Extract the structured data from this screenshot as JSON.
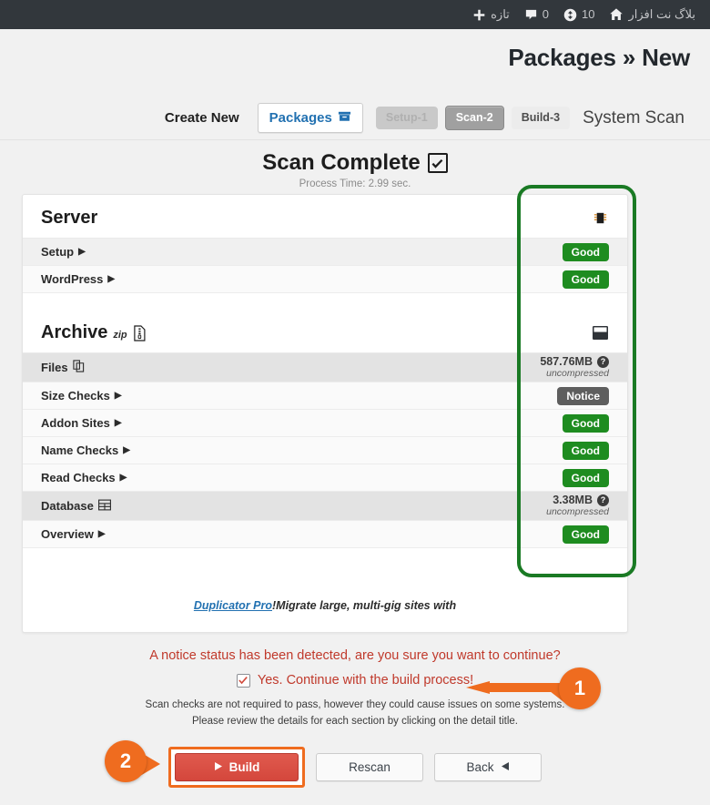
{
  "adminbar": {
    "home_icon": "home-icon",
    "site_name": "بلاگ نت افزار",
    "updates_icon": "updates-icon",
    "updates_count": "10",
    "comments_icon": "comments-icon",
    "comments_count": "0",
    "new_icon": "plus-icon",
    "new_label": "تازه"
  },
  "header": {
    "title": "Packages",
    "separator": "»",
    "subtitle": "New"
  },
  "nav": {
    "create_new": "Create New",
    "packages_label": "Packages",
    "packages_icon": "package-box-icon",
    "system_scan": "System Scan",
    "steps": [
      {
        "label": "Setup-1",
        "state": "todo"
      },
      {
        "label": "Scan-2",
        "state": "active"
      },
      {
        "label": "Build-3",
        "state": "done"
      }
    ]
  },
  "scan": {
    "title": "Scan Complete",
    "check_icon": "checkbox-checked-icon",
    "process_time": ".Process Time: 2.99 sec"
  },
  "sections": [
    {
      "name": "Server",
      "icon": "microchip-icon",
      "rows": [
        {
          "label": "Setup",
          "caret": "▶",
          "status": "Good",
          "kind": "good",
          "shade": "shade"
        },
        {
          "label": "WordPress",
          "caret": "▶",
          "status": "Good",
          "kind": "good",
          "shade": "white"
        }
      ]
    },
    {
      "name": "Archive",
      "sup": "zip",
      "sup_icon": "zip-file-icon",
      "icon": "archive-box-icon",
      "rows": [
        {
          "label": "Files",
          "icon": "copy-files-icon",
          "kind": "group",
          "size": "587.76MB",
          "size_note": "uncompressed",
          "shade": "group"
        },
        {
          "label": "Size Checks",
          "caret": "▶",
          "status": "Notice",
          "kind": "notice",
          "shade": "white"
        },
        {
          "label": "Addon Sites",
          "caret": "▶",
          "status": "Good",
          "kind": "good",
          "shade": "white"
        },
        {
          "label": "Name Checks",
          "caret": "▶",
          "status": "Good",
          "kind": "good",
          "shade": "white"
        },
        {
          "label": "Read Checks",
          "caret": "▶",
          "status": "Good",
          "kind": "good",
          "shade": "white"
        },
        {
          "label": "Database",
          "icon": "table-grid-icon",
          "kind": "group",
          "size": "3.38MB",
          "size_note": "uncompressed",
          "shade": "group"
        },
        {
          "label": "Overview",
          "caret": "▶",
          "status": "Good",
          "kind": "good",
          "shade": "white"
        }
      ]
    }
  ],
  "promo": {
    "text": "!Migrate large, multi-gig sites with ",
    "link": "Duplicator Pro"
  },
  "confirm": {
    "warning": "?A notice status has been detected, are you sure you want to continue",
    "yes_label": "!Yes. Continue with the build process",
    "checkbox_checked": true,
    "note_line1": ".Scan checks are not required to pass, however they could cause issues on some systems",
    "note_line2": ".Please review the details for each section by clicking on the detail title"
  },
  "buttons": {
    "build": "Build",
    "build_icon": "play-icon",
    "rescan": "Rescan",
    "back": "Back",
    "back_icon": "triangle-left-icon"
  },
  "callouts": [
    {
      "number": "1"
    },
    {
      "number": "2"
    }
  ],
  "colors": {
    "accent_orange": "#ef6c1f",
    "good_green": "#1e8c20",
    "notice_gray": "#5e5e5e",
    "build_red": "#d4473c",
    "link_blue": "#2271b1",
    "annotation_green": "#1a7a24",
    "warning_red": "#c0392b"
  }
}
